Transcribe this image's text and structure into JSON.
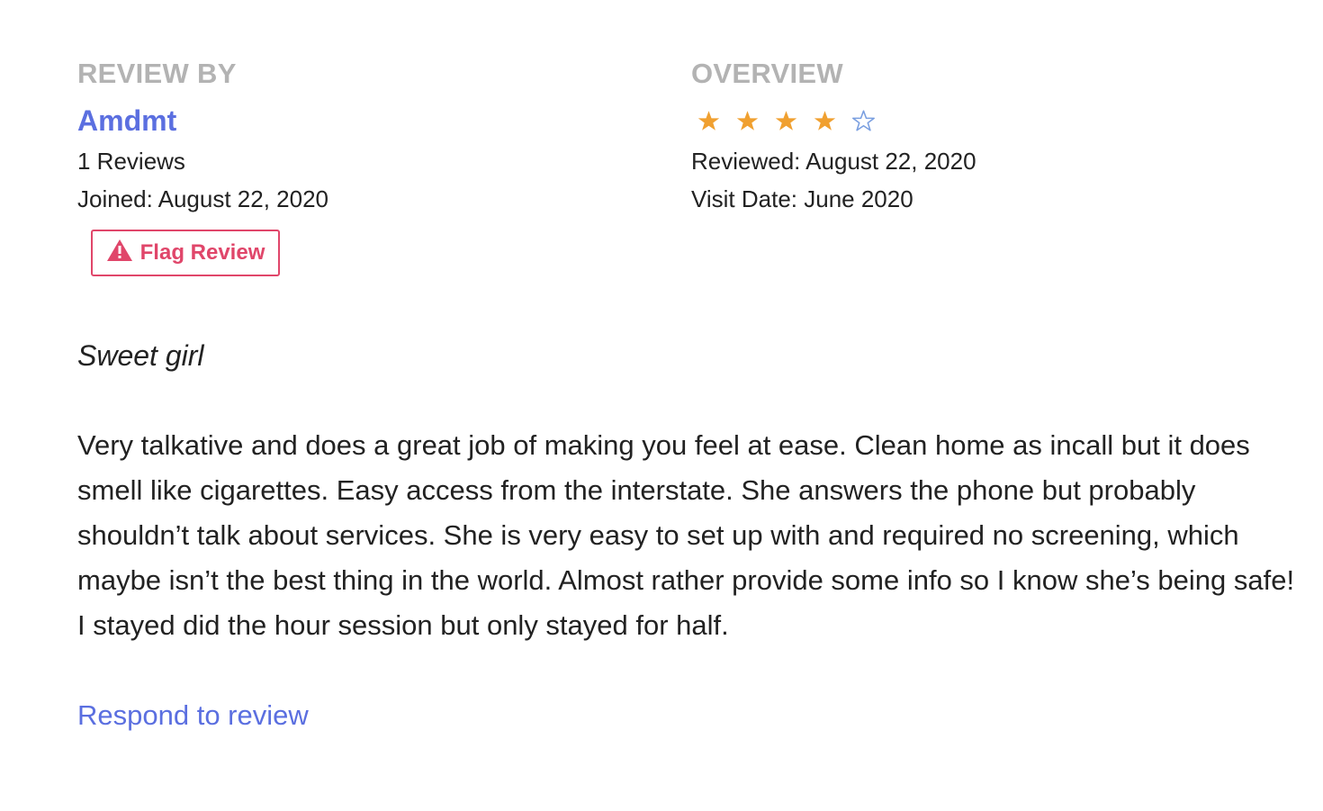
{
  "reviewer": {
    "section_label": "REVIEW BY",
    "name": "Amdmt",
    "reviews_count": "1 Reviews",
    "joined": "Joined: August 22, 2020",
    "flag_button_label": "Flag Review",
    "flag_icon": "warning-triangle-icon"
  },
  "overview": {
    "section_label": "OVERVIEW",
    "rating": 4,
    "rating_max": 5,
    "star_filled_color": "#f0a030",
    "star_empty_color": "#7a9fe0",
    "reviewed": "Reviewed: August 22, 2020",
    "visit_date": "Visit Date: June 2020"
  },
  "review": {
    "title": "Sweet girl",
    "body": "Very talkative and does a great job of making you feel at ease. Clean home as incall but it does smell like cigarettes. Easy access from the interstate. She answers the phone but probably shouldn’t talk about services. She is very easy to set up with and required no screening, which maybe isn’t the best thing in the world. Almost rather provide some info so I know she’s being safe! I stayed did the hour session but only stayed for half."
  },
  "actions": {
    "respond_label": "Respond to review"
  },
  "colors": {
    "accent": "#5b6fe0",
    "flag": "#e0466a",
    "label_gray": "#b3b3b3"
  }
}
